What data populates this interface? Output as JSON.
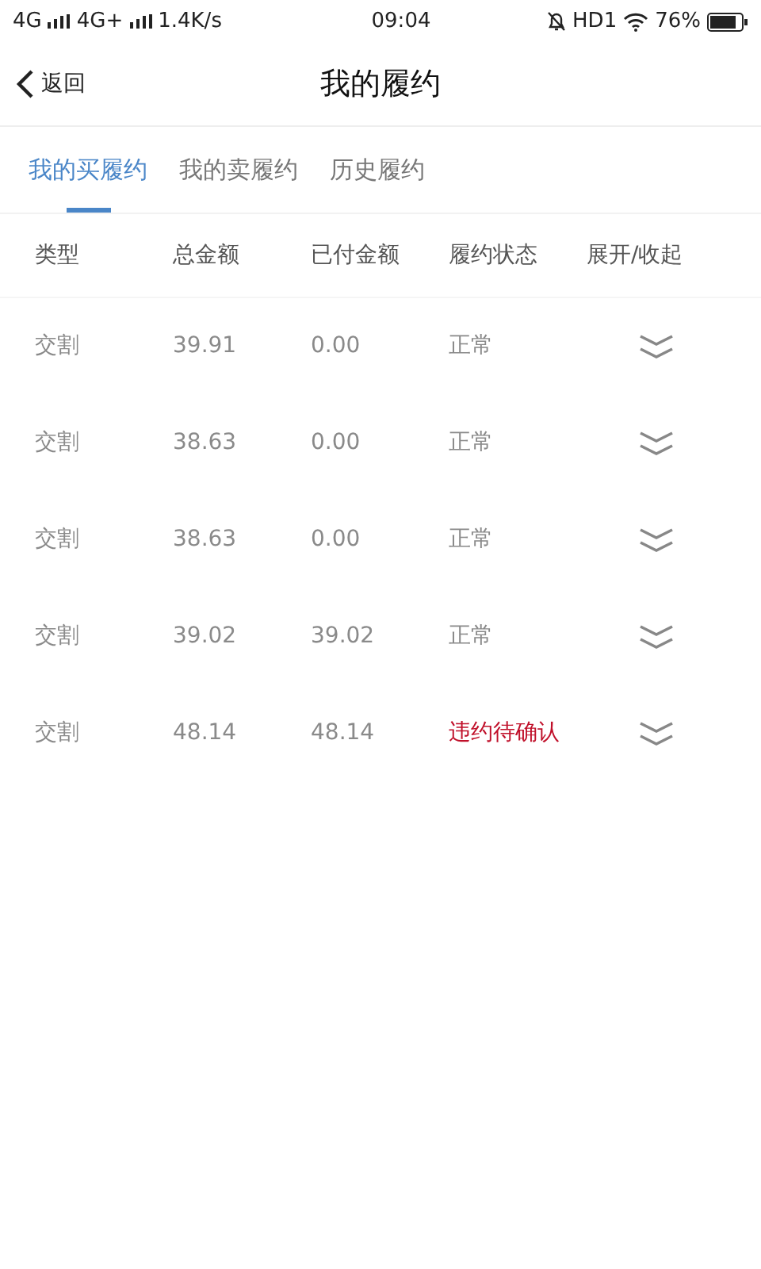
{
  "status_bar": {
    "left": [
      "4G",
      "4G+"
    ],
    "speed": "1.4K/s",
    "time": "09:04",
    "hd": "HD1",
    "battery": "76%"
  },
  "header": {
    "back": "返回",
    "title": "我的履约"
  },
  "tabs": [
    {
      "label": "我的买履约",
      "selected": true
    },
    {
      "label": "我的卖履约",
      "selected": false
    },
    {
      "label": "历史履约",
      "selected": false
    }
  ],
  "table": {
    "columns": [
      "类型",
      "总金额",
      "已付金额",
      "履约状态",
      "展开/收起"
    ],
    "rows": [
      {
        "type": "交割",
        "total": "39.91",
        "paid": "0.00",
        "status": "正常",
        "kind": "normal",
        "expanded": false
      },
      {
        "type": "交割",
        "total": "38.63",
        "paid": "0.00",
        "status": "正常",
        "kind": "normal",
        "expanded": false
      },
      {
        "type": "交割",
        "total": "38.63",
        "paid": "0.00",
        "status": "正常",
        "kind": "normal",
        "expanded": false
      },
      {
        "type": "交割",
        "total": "39.02",
        "paid": "39.02",
        "status": "正常",
        "kind": "normal",
        "expanded": false
      },
      {
        "type": "交割",
        "total": "48.14",
        "paid": "48.14",
        "status": "违约待确认",
        "kind": "breach",
        "expanded": false
      }
    ]
  }
}
